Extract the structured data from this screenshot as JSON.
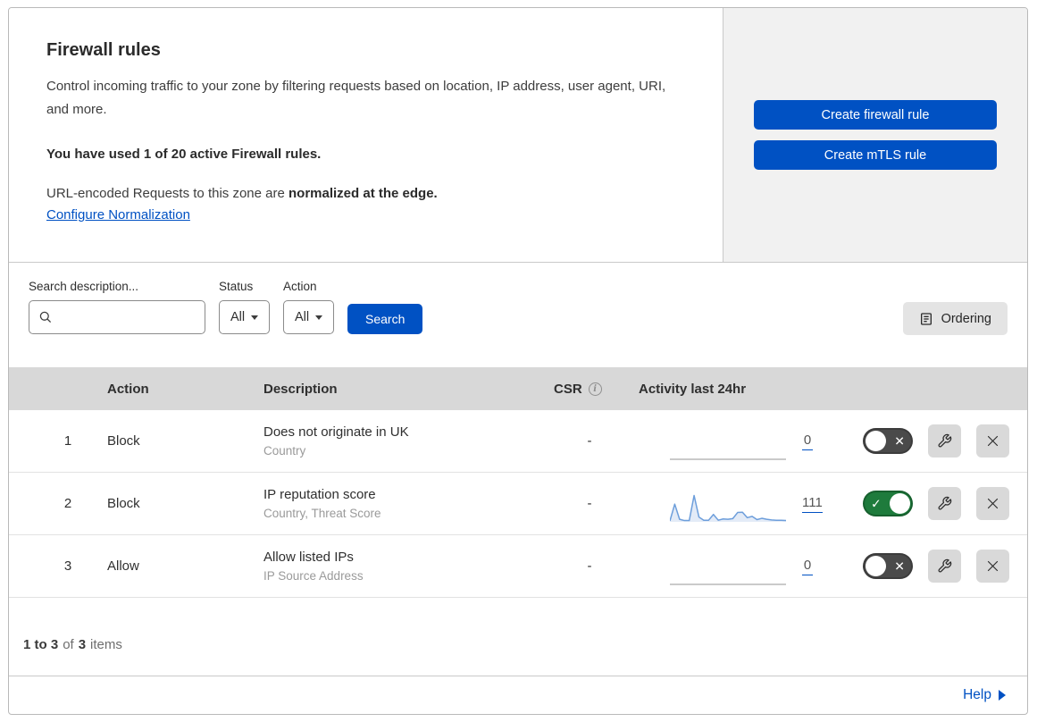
{
  "header": {
    "title": "Firewall rules",
    "description": "Control incoming traffic to your zone by filtering requests based on location, IP address, user agent, URI, and more.",
    "usage_bold": "You have used 1 of 20 active Firewall rules.",
    "normalization_prefix": "URL-encoded Requests to this zone are ",
    "normalization_bold": "normalized at the edge.",
    "normalization_link": "Configure Normalization",
    "create_firewall_button": "Create firewall rule",
    "create_mtls_button": "Create mTLS rule"
  },
  "filters": {
    "search_label": "Search description...",
    "search_value": "",
    "status_label": "Status",
    "status_value": "All",
    "action_label": "Action",
    "action_value": "All",
    "search_button": "Search",
    "ordering_button": "Ordering"
  },
  "table": {
    "columns": {
      "action": "Action",
      "description": "Description",
      "csr": "CSR",
      "activity": "Activity last 24hr"
    },
    "rows": [
      {
        "index": "1",
        "action": "Block",
        "description": "Does not originate in UK",
        "criteria": "Country",
        "csr": "-",
        "activity_count": "0",
        "enabled": false,
        "sparkline": []
      },
      {
        "index": "2",
        "action": "Block",
        "description": "IP reputation score",
        "criteria": "Country, Threat Score",
        "csr": "-",
        "activity_count": "111",
        "enabled": true,
        "sparkline": [
          3,
          55,
          8,
          4,
          4,
          82,
          15,
          5,
          5,
          23,
          5,
          9,
          8,
          10,
          29,
          30,
          13,
          17,
          7,
          11,
          8,
          6,
          5,
          5,
          4
        ]
      },
      {
        "index": "3",
        "action": "Allow",
        "description": "Allow listed IPs",
        "criteria": "IP Source Address",
        "csr": "-",
        "activity_count": "0",
        "enabled": false,
        "sparkline": []
      }
    ]
  },
  "footer": {
    "items_range": "1 to 3",
    "of_label": "of",
    "items_total": "3",
    "items_label": "items",
    "help_label": "Help"
  },
  "colors": {
    "accent_blue": "#0051c3",
    "panel_gray": "#f1f1f1",
    "table_header_gray": "#d8d8d8",
    "toggle_on_green": "#1e7b3c",
    "toggle_off_gray": "#4a4a4a",
    "sparkline_blue": "#6d9edb",
    "sparkline_fill": "#e3ebf7",
    "flatline_gray": "#b9b9b9"
  }
}
